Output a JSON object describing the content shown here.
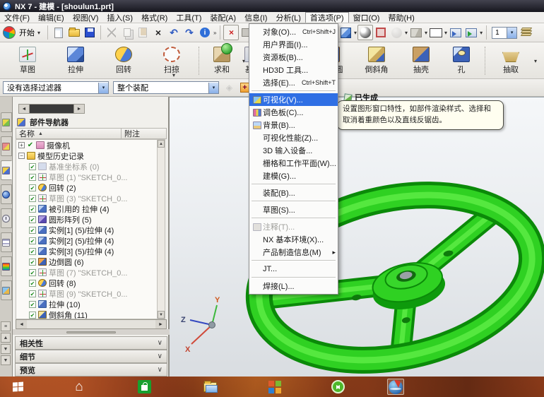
{
  "window": {
    "title": "NX 7 - 建模 - [shoulun1.prt]"
  },
  "menubar": {
    "items": [
      {
        "label": "文件(F)"
      },
      {
        "label": "编辑(E)"
      },
      {
        "label": "视图(V)"
      },
      {
        "label": "插入(S)"
      },
      {
        "label": "格式(R)"
      },
      {
        "label": "工具(T)"
      },
      {
        "label": "装配(A)"
      },
      {
        "label": "信息(I)"
      },
      {
        "label": "分析(L)"
      },
      {
        "label": "首选项(P)"
      },
      {
        "label": "窗口(O)"
      },
      {
        "label": "帮助(H)"
      }
    ]
  },
  "standard_toolbar": {
    "start_label": "开始",
    "layer_combo_value": "1"
  },
  "feature_toolbar": {
    "buttons": [
      {
        "label": "草图"
      },
      {
        "label": "拉伸"
      },
      {
        "label": "回转"
      },
      {
        "label": "扫掠"
      },
      {
        "label": "求和"
      },
      {
        "label": "基准"
      },
      {
        "label": "边倒圆"
      },
      {
        "label": "倒斜角"
      },
      {
        "label": "抽壳"
      },
      {
        "label": "孔"
      },
      {
        "label": "抽取"
      }
    ]
  },
  "selection_bar": {
    "filter_value": "没有选择过滤器",
    "scope_value": "整个装配"
  },
  "preferences_menu": {
    "items": [
      {
        "label": "对象(O)...",
        "shortcut": "Ctrl+Shift+J"
      },
      {
        "label": "用户界面(I)..."
      },
      {
        "label": "资源板(B)..."
      },
      {
        "label": "HD3D 工具..."
      },
      {
        "label": "选择(E)...",
        "shortcut": "Ctrl+Shift+T"
      },
      {
        "label": "可视化(V)..."
      },
      {
        "label": "调色板(C)..."
      },
      {
        "label": "背景(B)..."
      },
      {
        "label": "可视化性能(Z)..."
      },
      {
        "label": "3D 输入设备..."
      },
      {
        "label": "栅格和工作平面(W)..."
      },
      {
        "label": "建模(G)..."
      },
      {
        "label": "装配(B)..."
      },
      {
        "label": "草图(S)..."
      },
      {
        "label": "注释(T)..."
      },
      {
        "label": "NX 基本环境(X)..."
      },
      {
        "label": "产品制造信息(M)"
      },
      {
        "label": "JT..."
      },
      {
        "label": "焊接(L)..."
      }
    ]
  },
  "tooltip": {
    "title": "已生成",
    "body": "设置图形窗口特性，如部件渲染样式、选择和取消着重颜色以及直线反锯齿。"
  },
  "navigator": {
    "title": "部件导航器",
    "columns": {
      "name": "名称",
      "note": "附注"
    },
    "items": [
      {
        "label": "摄像机"
      },
      {
        "label": "模型历史记录"
      },
      {
        "label": "基准坐标系 (0)"
      },
      {
        "label": "草图 (1) \"SKETCH_0..."
      },
      {
        "label": "回转 (2)"
      },
      {
        "label": "草图 (3) \"SKETCH_0..."
      },
      {
        "label": "被引用的 拉伸 (4)"
      },
      {
        "label": "圆形阵列 (5)"
      },
      {
        "label": "实例[1] (5)/拉伸 (4)"
      },
      {
        "label": "实例[2] (5)/拉伸 (4)"
      },
      {
        "label": "实例[3] (5)/拉伸 (4)"
      },
      {
        "label": "边倒圆 (6)"
      },
      {
        "label": "草图 (7) \"SKETCH_0..."
      },
      {
        "label": "回转 (8)"
      },
      {
        "label": "草图 (9) \"SKETCH_0..."
      },
      {
        "label": "拉伸 (10)"
      },
      {
        "label": "倒斜角 (11)"
      }
    ],
    "sections": [
      {
        "label": "相关性"
      },
      {
        "label": "细节"
      },
      {
        "label": "预览"
      }
    ]
  },
  "viewport": {
    "triad": {
      "x": "X",
      "y": "Y",
      "z": "Z"
    }
  },
  "icons": {
    "chevron_down": "▾",
    "overflow": "»",
    "submenu": "▸",
    "check": "✔",
    "close": "×",
    "undo": "↶",
    "redo": "↷",
    "plus": "+",
    "minus": "−",
    "left": "◄",
    "right": "►",
    "up": "▲",
    "down": "▼",
    "section_chevron": "∨",
    "sort": "▲",
    "dock": "≡"
  },
  "colors": {
    "highlight": "#2f6fe4",
    "wheel_green": "#2fd122",
    "titlebar": "#16161e"
  }
}
